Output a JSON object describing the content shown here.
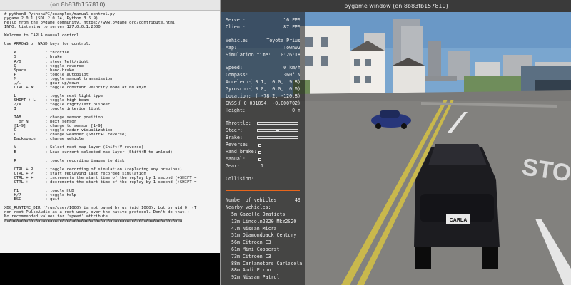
{
  "terminal": {
    "title": "(on 8b83fb157810)",
    "lines": [
      "# python3 PythonAPI/examples/manual_control.py",
      "pygame 2.0.1 (SDL 2.0.14, Python 3.6.9)",
      "Hello from the pygame community. https://www.pygame.org/contribute.html",
      "INFO: listening to server 127.0.0.1:2000",
      "",
      "Welcome to CARLA manual control.",
      "",
      "Use ARROWS or WASD keys for control.",
      "",
      "    W            : throttle",
      "    S            : brake",
      "    A/D          : steer left/right",
      "    Q            : toggle reverse",
      "    Space        : hand-brake",
      "    P            : toggle autopilot",
      "    M            : toggle manual transmission",
      "    ,/.          : gear up/down",
      "    CTRL + W     : toggle constant velocity mode at 60 km/h",
      "",
      "    L            : toggle next light type",
      "    SHIFT + L    : toggle high beam",
      "    Z/X          : toggle right/left blinker",
      "    I            : toggle interior light",
      "",
      "    TAB          : change sensor position",
      "    ` or N       : next sensor",
      "    [1-9]        : change to sensor [1-9]",
      "    G            : toggle radar visualization",
      "    C            : change weather (Shift+C reverse)",
      "    Backspace    : change vehicle",
      "",
      "    V            : Select next map layer (Shift+V reverse)",
      "    B            : Load current selected map layer (Shift+B to unload)",
      "",
      "    R            : toggle recording images to disk",
      "",
      "    CTRL + R     : toggle recording of simulation (replacing any previous)",
      "    CTRL + P     : start replaying last recorded simulation",
      "    CTRL + +     : increments the start time of the replay by 1 second (+SHIFT =",
      "    CTRL + -     : decrements the start time of the replay by 1 second (+SHIFT =",
      "",
      "    F1           : toggle HUD",
      "    H/?          : toggle help",
      "    ESC          : quit",
      "",
      "XDG_RUNTIME_DIR (/run/user/1000) is not owned by us (uid 1000), but by uid 0! (T",
      "non-root PulseAudio as a root user, over the native protocol. Don't do that.)",
      "No recommended values for 'speed' attribute",
      "WWWWWWWWWWWWWWWWWWWWWWWWWWWWWWWWWWWWWWWWWWWWWWWWWWWWWWWWWWWWWWWWWWWWWWWWWW"
    ]
  },
  "pygame": {
    "title": "pygame window (on 8b83fb157810)",
    "hud": {
      "server_label": "Server:",
      "server_value": "16 FPS",
      "client_label": "Client:",
      "client_value": "87 FPS",
      "vehicle_label": "Vehicle:",
      "vehicle_value": "Toyota Prius",
      "map_label": "Map:",
      "map_value": "Town02",
      "simtime_label": "Simulation time:",
      "simtime_value": "0:26:18",
      "speed_label": "Speed:",
      "speed_value": "0 km/h",
      "compass_label": "Compass:",
      "compass_value": "360° N",
      "accel_label": "Accelero:",
      "accel_value": "( 0.1,  0.0,  9.8)",
      "gyro_label": "Gyroscop:",
      "gyro_value": "( 0.0,  0.0,  0.0)",
      "location_label": "Location:",
      "location_value": "( -78.2, -120.8)",
      "gnss_label": "GNSS:",
      "gnss_value": "( 0.001094, -0.000702)",
      "height_label": "Height:",
      "height_value": "0 m",
      "throttle_label": "Throttle:",
      "throttle_value": 0.0,
      "steer_label": "Steer:",
      "steer_value": 0.0,
      "brake_label": "Brake:",
      "brake_value": 0.0,
      "reverse_label": "Reverse:",
      "reverse_on": false,
      "handbrake_label": "Hand brake:",
      "handbrake_on": false,
      "manual_label": "Manual:",
      "manual_on": false,
      "gear_label": "Gear:",
      "gear_value": "1",
      "collision_label": "Collision:",
      "vehicles_count_label": "Number of vehicles:",
      "vehicles_count_value": "49",
      "nearby_label": "Nearby vehicles:",
      "nearby": [
        "5m Gazelle Omafiets",
        "13m Lincoln2020 Mkz2020",
        "47m Nissan Micra",
        "51m Diamondback Century",
        "56m Citroen C3",
        "61m Mini Cooperst",
        "73m Citroen C3",
        "88m Carlamotors Carlacola",
        "88m Audi Etron",
        "92m Nissan Patrol"
      ]
    },
    "scene": {
      "plate_text": "CARLA",
      "sign_text": "STOP"
    }
  }
}
